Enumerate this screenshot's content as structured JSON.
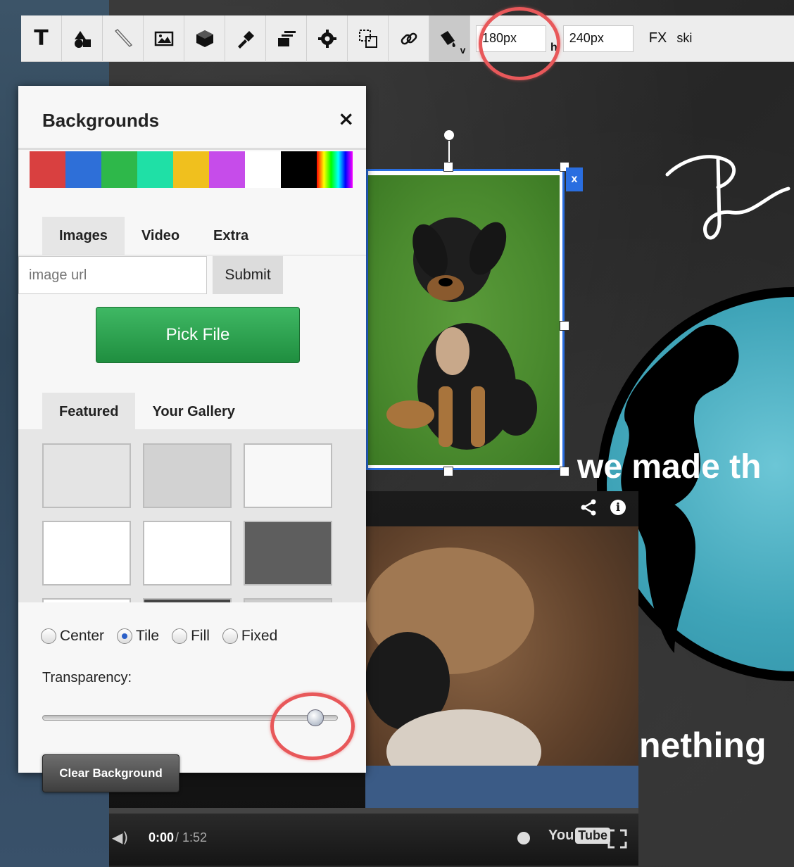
{
  "toolbar": {
    "tools": [
      "text",
      "shapes",
      "draw",
      "image",
      "widget",
      "brush",
      "layers",
      "settings",
      "duplicate",
      "link",
      "background"
    ],
    "text_tool_glyph": "T",
    "background_tool_sub": "v",
    "width_value": "180px",
    "height_label": "h",
    "height_value": "240px",
    "fx_label": "FX",
    "skin_label": "ski"
  },
  "panel": {
    "title": "Backgrounds",
    "close_glyph": "×",
    "swatches": [
      "#d94040",
      "#2e6fd8",
      "#2eb84a",
      "#1fe0a6",
      "#f0c01e",
      "#c64cea",
      "#ffffff",
      "#000000",
      "rainbow"
    ],
    "tabs": [
      "Images",
      "Video",
      "Extra"
    ],
    "url_placeholder": "image url",
    "submit_label": "Submit",
    "pick_file_label": "Pick File",
    "gallery_tabs": [
      "Featured",
      "Your Gallery"
    ],
    "position_options": [
      {
        "label": "Center",
        "checked": false
      },
      {
        "label": "Tile",
        "checked": true
      },
      {
        "label": "Fill",
        "checked": false
      },
      {
        "label": "Fixed",
        "checked": false
      }
    ],
    "transparency_label": "Transparency:",
    "transparency_fraction": 0.95,
    "clear_label": "Clear Background"
  },
  "canvas": {
    "headline_1": "we made th",
    "headline_2": "nething"
  },
  "video": {
    "current_time": "0:00",
    "duration": "/ 1:52",
    "logo_you": "You",
    "logo_tube": "Tube",
    "info_glyph": "i"
  }
}
